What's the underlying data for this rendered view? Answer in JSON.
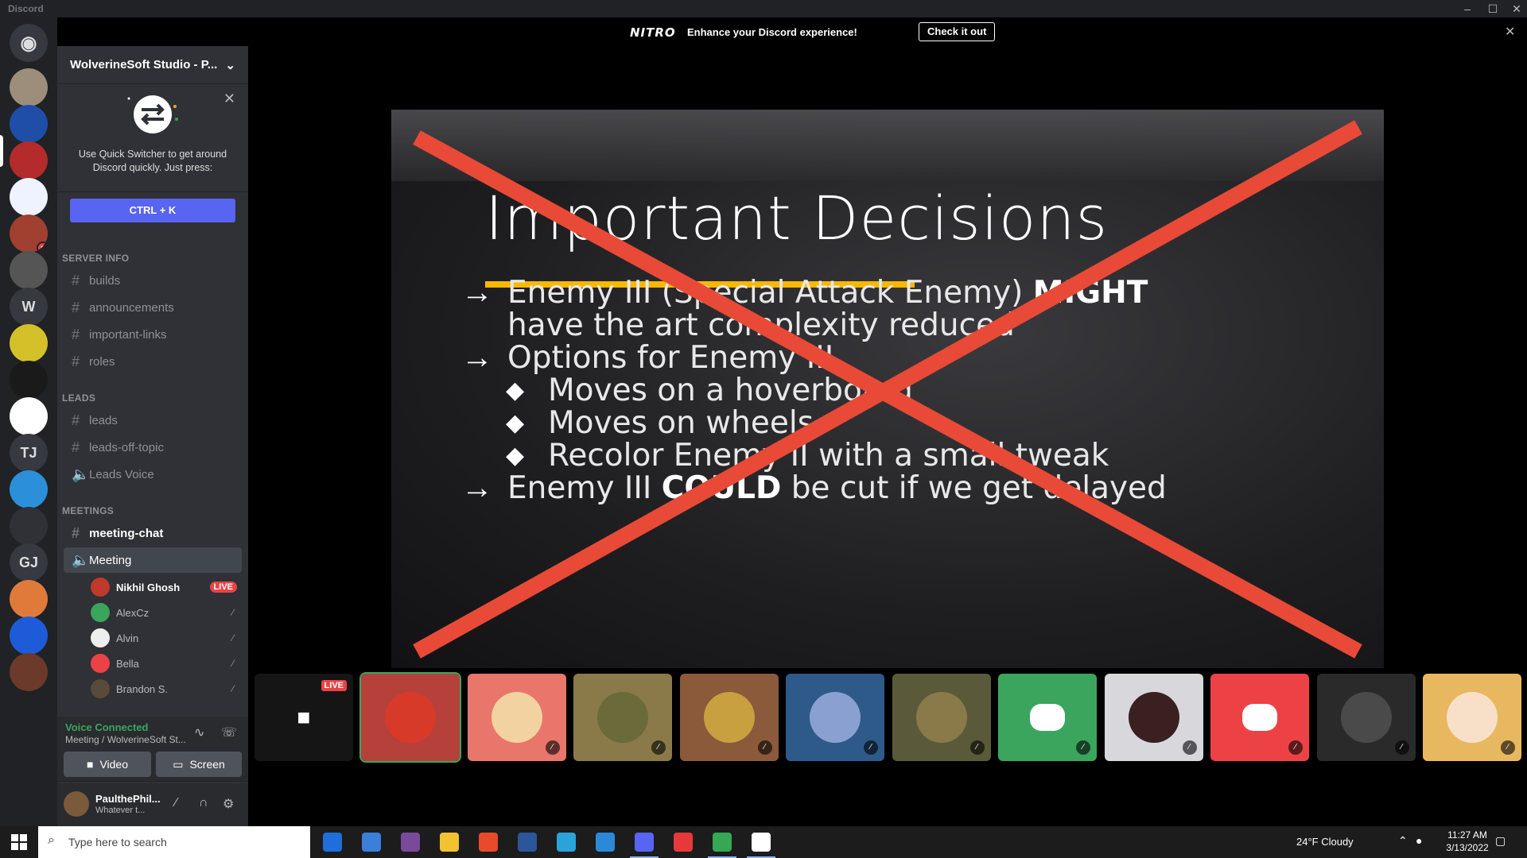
{
  "window": {
    "title": "Discord",
    "controls": [
      "–",
      "☐",
      "✕"
    ]
  },
  "nitro": {
    "logo": "NITRO",
    "message": "Enhance your Discord experience!",
    "cta": "Check it out",
    "close": "✕"
  },
  "rail": {
    "servers": [
      {
        "name": "home",
        "color": "#36393f"
      },
      {
        "name": "fox-server",
        "color": "#9c8e7a"
      },
      {
        "name": "yin-yang-server",
        "color": "#1e4ea8"
      },
      {
        "name": "wolverinesoft-server",
        "color": "#b32b2b"
      },
      {
        "name": "knot-server",
        "color": "#eef3ff"
      },
      {
        "name": "sunglasses-server",
        "color": "#a04030",
        "badge": "2"
      },
      {
        "name": "arcade-server",
        "color": "#555555"
      },
      {
        "name": "w-server",
        "text": "W",
        "color": "#36393f"
      },
      {
        "name": "gold-server",
        "color": "#d4c12a"
      },
      {
        "name": "skull-server",
        "color": "#1a1a1a"
      },
      {
        "name": "flag-server",
        "color": "#ffffff"
      },
      {
        "name": "tj-server",
        "text": "TJ",
        "color": "#36393f"
      },
      {
        "name": "robot-server",
        "color": "#2c8fd9"
      },
      {
        "name": "controller-server",
        "color": "#2f3136"
      },
      {
        "name": "gj-server",
        "text": "GJ",
        "color": "#36393f"
      },
      {
        "name": "book-server",
        "color": "#e07a3a"
      },
      {
        "name": "m-server",
        "color": "#1e5bd8"
      },
      {
        "name": "bloom-server",
        "color": "#6b3a2a"
      }
    ]
  },
  "sidebar": {
    "server_name": "WolverineSoft Studio - P...",
    "quick_switcher": {
      "tip": "Use Quick Switcher to get around Discord quickly. Just press:",
      "shortcut": "CTRL + K"
    },
    "categories": [
      {
        "label": "SERVER INFO",
        "channels": [
          "builds",
          "announcements",
          "important-links",
          "roles"
        ]
      },
      {
        "label": "LEADS",
        "channels": [
          "leads",
          "leads-off-topic"
        ],
        "voice": "Leads Voice"
      },
      {
        "label": "MEETINGS",
        "channels": [
          "meeting-chat"
        ],
        "voice": "Meeting"
      }
    ],
    "voice_users": [
      {
        "name": "Nikhil Ghosh",
        "live": "LIVE",
        "color": "#c0392b"
      },
      {
        "name": "AlexCz",
        "color": "#3ba55d"
      },
      {
        "name": "Alvin",
        "color": "#eeeeee"
      },
      {
        "name": "Bella",
        "color": "#ed4245"
      },
      {
        "name": "Brandon S.",
        "color": "#5a4a3a"
      }
    ]
  },
  "voice": {
    "status": "Voice Connected",
    "channel": "Meeting / WolverineSoft St...",
    "video": "Video",
    "screen": "Screen"
  },
  "user": {
    "name": "PaulthePhil...",
    "status": "Whatever t..."
  },
  "slide": {
    "title": "Important Decisions",
    "bullets": [
      {
        "pre": "Enemy III (Special Attack Enemy) ",
        "bold": "MIGHT"
      },
      {
        "pre": "have the art complexity reduced",
        "bold": ""
      },
      {
        "pre": "Options for Enemy III",
        "bold": ""
      }
    ],
    "sub_bullets": [
      "Moves on a hoverboard",
      "Moves on wheels",
      "Recolor Enemy II with a small tweak"
    ],
    "last": {
      "pre": "Enemy III ",
      "bold": "COULD",
      "post": " be cut if we get delayed"
    },
    "accent": "#f9b800",
    "cross_color": "#e84a37"
  },
  "strip": {
    "live_label": "LIVE",
    "tiles": [
      {
        "name": "spiderman",
        "bg": "#b5413a",
        "fg": "#d83a2a",
        "selected": true
      },
      {
        "name": "chicken",
        "bg": "#e8766a",
        "fg": "#f2d2a0"
      },
      {
        "name": "warrior",
        "bg": "#8a7a4a",
        "fg": "#6a6a3a"
      },
      {
        "name": "colorful",
        "bg": "#8a5a3a",
        "fg": "#c8a040"
      },
      {
        "name": "planet",
        "bg": "#2e5a8a",
        "fg": "#8aa0d0"
      },
      {
        "name": "redhead",
        "bg": "#5a5a3a",
        "fg": "#8a7a4a"
      },
      {
        "name": "discord-green",
        "bg": "#3ba55d",
        "fg": "#ffffff",
        "discord": true
      },
      {
        "name": "helmet",
        "bg": "#d8d8dc",
        "fg": "#3a2020"
      },
      {
        "name": "discord-red",
        "bg": "#ed4245",
        "fg": "#ffffff",
        "discord": true
      },
      {
        "name": "dark",
        "bg": "#2a2a2a",
        "fg": "#4a4a4a"
      },
      {
        "name": "girl",
        "bg": "#e8b860",
        "fg": "#f8e0c8"
      }
    ]
  },
  "taskbar": {
    "search_placeholder": "Type here to search",
    "weather": "24°F  Cloudy",
    "time": "11:27 AM",
    "date": "3/13/2022",
    "apps": [
      {
        "name": "calculator",
        "color": "#1e6fd9"
      },
      {
        "name": "mail",
        "color": "#3a7fd9"
      },
      {
        "name": "github-desktop",
        "color": "#7a4a9a"
      },
      {
        "name": "file-explorer",
        "color": "#f2c230"
      },
      {
        "name": "office",
        "color": "#e84a2a"
      },
      {
        "name": "word",
        "color": "#2b579a"
      },
      {
        "name": "edge",
        "color": "#2aa3d9"
      },
      {
        "name": "vscode",
        "color": "#2a8ad9"
      },
      {
        "name": "discord",
        "color": "#5865f2"
      },
      {
        "name": "itunes",
        "color": "#e8393a"
      },
      {
        "name": "chrome",
        "color": "#34a853"
      },
      {
        "name": "unity",
        "color": "#ffffff"
      }
    ]
  }
}
